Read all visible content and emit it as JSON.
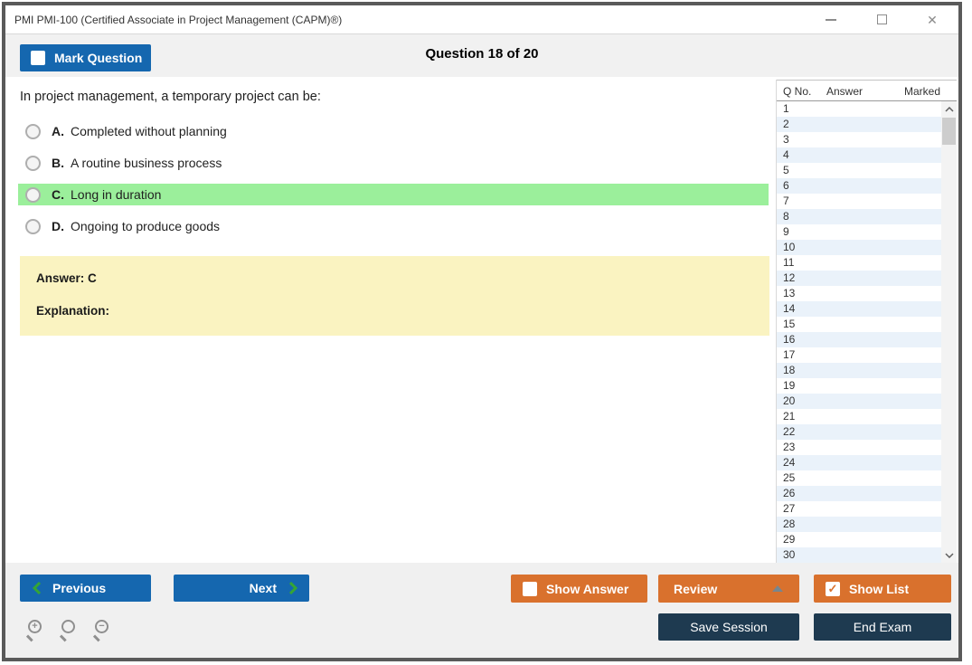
{
  "window": {
    "title": "PMI PMI-100 (Certified Associate in Project Management (CAPM)®)",
    "close_glyph": "✕"
  },
  "header": {
    "mark_question": {
      "label": "Mark Question",
      "checked": false,
      "check_glyph": ""
    },
    "question_counter": "Question 18 of 20"
  },
  "question": {
    "text": "In project management, a temporary project can be:",
    "options": [
      {
        "letter": "A.",
        "text": "Completed without planning",
        "highlighted": false
      },
      {
        "letter": "B.",
        "text": "A routine business process",
        "highlighted": false
      },
      {
        "letter": "C.",
        "text": "Long in duration",
        "highlighted": true
      },
      {
        "letter": "D.",
        "text": "Ongoing to produce goods",
        "highlighted": false
      }
    ],
    "answer_label": "Answer: C",
    "explanation_label": "Explanation:"
  },
  "question_list": {
    "columns": {
      "qno": "Q No.",
      "answer": "Answer",
      "marked": "Marked"
    },
    "rows": [
      {
        "q": "1",
        "answer": "",
        "marked": ""
      },
      {
        "q": "2",
        "answer": "",
        "marked": ""
      },
      {
        "q": "3",
        "answer": "",
        "marked": ""
      },
      {
        "q": "4",
        "answer": "",
        "marked": ""
      },
      {
        "q": "5",
        "answer": "",
        "marked": ""
      },
      {
        "q": "6",
        "answer": "",
        "marked": ""
      },
      {
        "q": "7",
        "answer": "",
        "marked": ""
      },
      {
        "q": "8",
        "answer": "",
        "marked": ""
      },
      {
        "q": "9",
        "answer": "",
        "marked": ""
      },
      {
        "q": "10",
        "answer": "",
        "marked": ""
      },
      {
        "q": "11",
        "answer": "",
        "marked": ""
      },
      {
        "q": "12",
        "answer": "",
        "marked": ""
      },
      {
        "q": "13",
        "answer": "",
        "marked": ""
      },
      {
        "q": "14",
        "answer": "",
        "marked": ""
      },
      {
        "q": "15",
        "answer": "",
        "marked": ""
      },
      {
        "q": "16",
        "answer": "",
        "marked": ""
      },
      {
        "q": "17",
        "answer": "",
        "marked": ""
      },
      {
        "q": "18",
        "answer": "",
        "marked": ""
      },
      {
        "q": "19",
        "answer": "",
        "marked": ""
      },
      {
        "q": "20",
        "answer": "",
        "marked": ""
      },
      {
        "q": "21",
        "answer": "",
        "marked": ""
      },
      {
        "q": "22",
        "answer": "",
        "marked": ""
      },
      {
        "q": "23",
        "answer": "",
        "marked": ""
      },
      {
        "q": "24",
        "answer": "",
        "marked": ""
      },
      {
        "q": "25",
        "answer": "",
        "marked": ""
      },
      {
        "q": "26",
        "answer": "",
        "marked": ""
      },
      {
        "q": "27",
        "answer": "",
        "marked": ""
      },
      {
        "q": "28",
        "answer": "",
        "marked": ""
      },
      {
        "q": "29",
        "answer": "",
        "marked": ""
      },
      {
        "q": "30",
        "answer": "",
        "marked": ""
      }
    ]
  },
  "footer": {
    "previous_label": "Previous",
    "next_label": "Next",
    "show_answer": {
      "label": "Show Answer",
      "checked": false,
      "check_glyph": ""
    },
    "review_label": "Review",
    "show_list": {
      "label": "Show List",
      "checked": true,
      "check_glyph": "✓"
    },
    "save_session_label": "Save Session",
    "end_exam_label": "End Exam"
  },
  "colors": {
    "accent_blue": "#1567af",
    "accent_orange": "#d9712d",
    "accent_navy": "#1e3a50",
    "highlight_green": "#9bef9b",
    "answer_box_yellow": "#faf3c1",
    "row_alt_blue": "#eaf2fa",
    "chevron_green": "#35a535"
  }
}
